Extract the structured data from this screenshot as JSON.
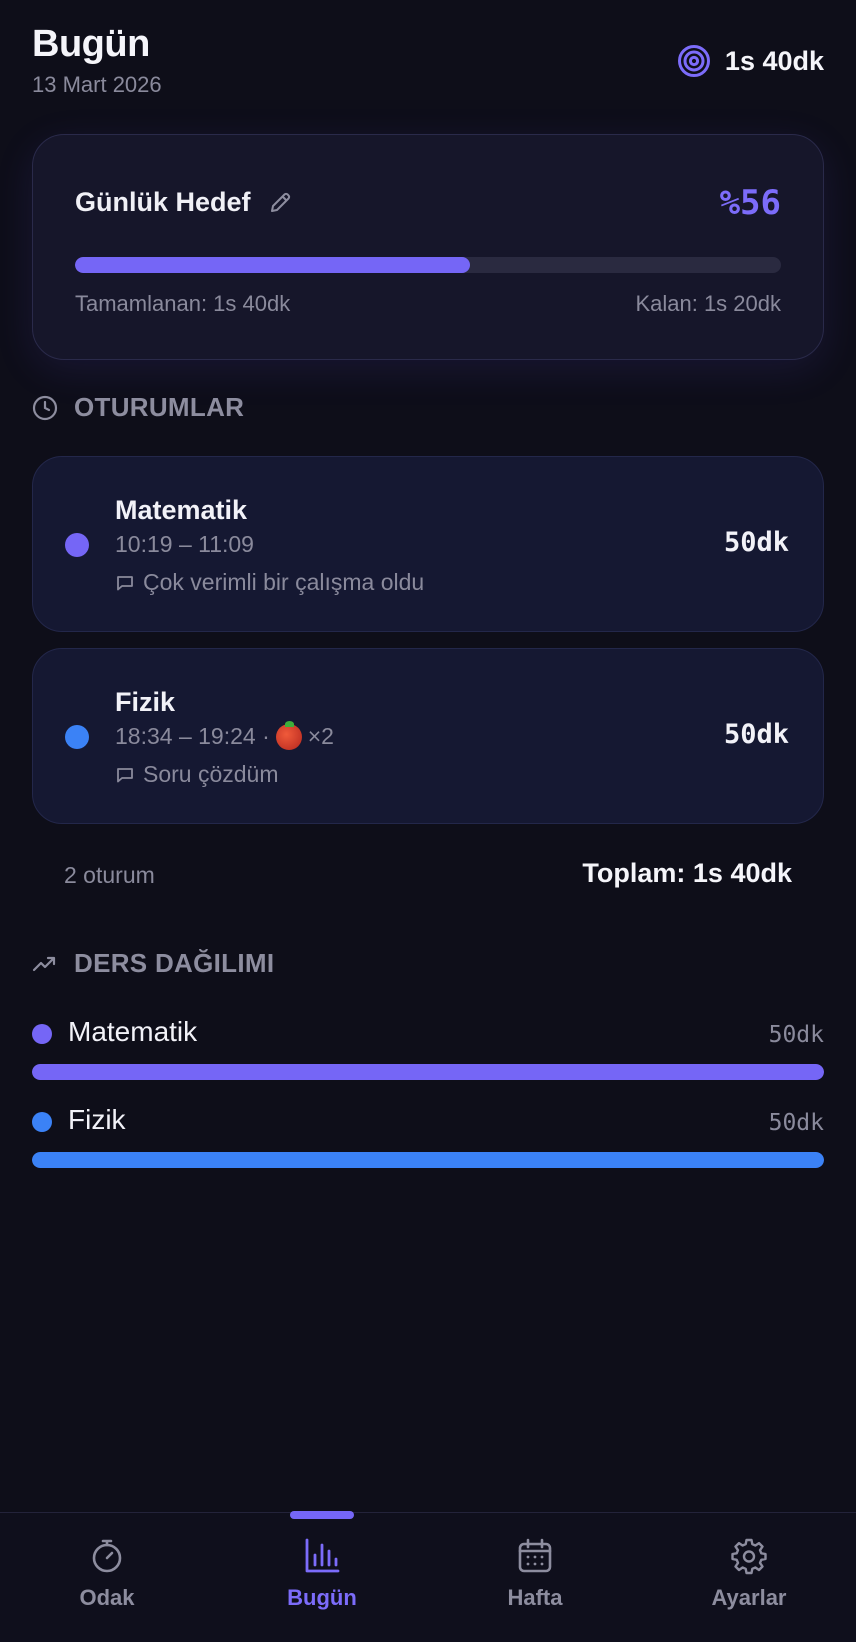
{
  "header": {
    "title": "Bugün",
    "date": "13 Mart 2026",
    "total": "1s 40dk",
    "total_icon": "target-icon"
  },
  "goal": {
    "title": "Günlük Hedef",
    "percent_label": "%56",
    "progress": 0.56,
    "completed": "Tamamlanan: 1s 40dk",
    "remaining": "Kalan: 1s 20dk",
    "accent": "#7566f6"
  },
  "sessions_section": {
    "title": "OTURUMLAR",
    "icon": "clock-icon"
  },
  "sessions": [
    {
      "subject": "Matematik",
      "time": "10:19 – 11:09",
      "pomodoro": "",
      "note": "Çok verimli bir çalışma oldu",
      "duration": "50dk",
      "color": "#7566f6"
    },
    {
      "subject": "Fizik",
      "time": "18:34 – 19:24 ·",
      "pomodoro": "×2",
      "note": "Soru çözdüm",
      "duration": "50dk",
      "color": "#3b82f6"
    }
  ],
  "summary": {
    "count": "2 oturum",
    "total": "Toplam: 1s 40dk"
  },
  "distribution_section": {
    "title": "DERS DAĞILIMI",
    "icon": "trend-up-icon"
  },
  "distribution": [
    {
      "subject": "Matematik",
      "duration": "50dk",
      "share": 1.0,
      "color": "#7566f6"
    },
    {
      "subject": "Fizik",
      "duration": "50dk",
      "share": 1.0,
      "color": "#3b82f6"
    }
  ],
  "nav": {
    "active": "Bugün",
    "items": [
      {
        "label": "Odak",
        "icon": "stopwatch-icon"
      },
      {
        "label": "Bugün",
        "icon": "bar-chart-icon"
      },
      {
        "label": "Hafta",
        "icon": "calendar-icon"
      },
      {
        "label": "Ayarlar",
        "icon": "gear-icon"
      }
    ]
  }
}
